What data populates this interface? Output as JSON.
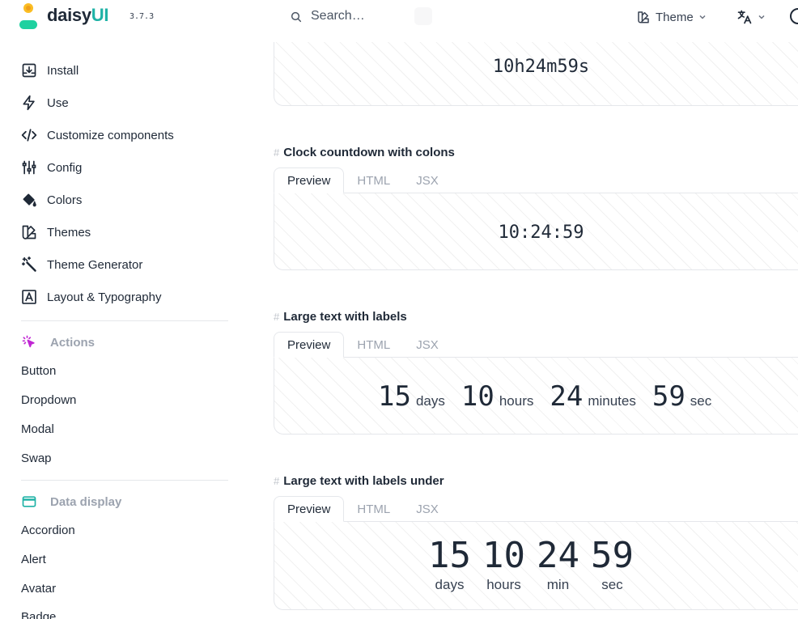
{
  "brand": {
    "name_main": "daisy",
    "name_accent": "UI",
    "version": "3.7.3"
  },
  "search": {
    "placeholder": "Search…"
  },
  "topbar": {
    "theme_label": "Theme"
  },
  "sidebar": {
    "items": [
      {
        "label": "Install",
        "icon": "install-icon"
      },
      {
        "label": "Use",
        "icon": "bolt-icon"
      },
      {
        "label": "Customize components",
        "icon": "code-icon"
      },
      {
        "label": "Config",
        "icon": "sliders-icon"
      },
      {
        "label": "Colors",
        "icon": "paint-bucket-icon"
      },
      {
        "label": "Themes",
        "icon": "swatch-icon"
      },
      {
        "label": "Theme Generator",
        "icon": "magic-wand-icon"
      },
      {
        "label": "Layout & Typography",
        "icon": "typography-icon"
      }
    ],
    "sections": [
      {
        "title": "Actions",
        "icon": "cursor-click-icon",
        "color": "#c026d3",
        "items": [
          "Button",
          "Dropdown",
          "Modal",
          "Swap"
        ]
      },
      {
        "title": "Data display",
        "icon": "window-icon",
        "color": "#1fb2a6",
        "items": [
          "Accordion",
          "Alert",
          "Avatar",
          "Badge"
        ]
      }
    ]
  },
  "main": {
    "example0": {
      "value": "10h24m59s"
    },
    "example1": {
      "title": "Clock countdown with colons",
      "tabs": [
        "Preview",
        "HTML",
        "JSX"
      ],
      "value": "10:24:59"
    },
    "example2": {
      "title": "Large text with labels",
      "tabs": [
        "Preview",
        "HTML",
        "JSX"
      ],
      "units": [
        {
          "num": "15",
          "label": "days"
        },
        {
          "num": "10",
          "label": "hours"
        },
        {
          "num": "24",
          "label": "minutes"
        },
        {
          "num": "59",
          "label": "sec"
        }
      ]
    },
    "example3": {
      "title": "Large text with labels under",
      "tabs": [
        "Preview",
        "HTML",
        "JSX"
      ],
      "units": [
        {
          "num": "15",
          "label": "days"
        },
        {
          "num": "10",
          "label": "hours"
        },
        {
          "num": "24",
          "label": "min"
        },
        {
          "num": "59",
          "label": "sec"
        }
      ]
    }
  },
  "heading_hash": "#"
}
